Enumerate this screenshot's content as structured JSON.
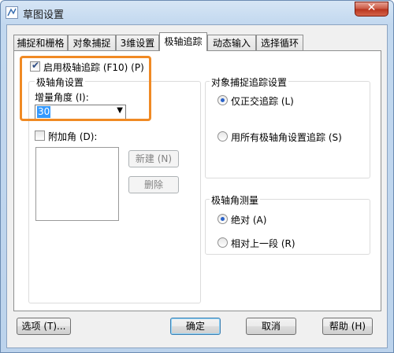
{
  "window": {
    "title": "草图设置",
    "close_glyph": "✕"
  },
  "tabs": [
    "捕捉和栅格",
    "对象捕捉",
    "3维设置",
    "极轴追踪",
    "动态输入",
    "选择循环"
  ],
  "active_tab": "极轴追踪",
  "polar": {
    "enable_label": "启用极轴追踪 (F10) (P)",
    "enable_checked": true,
    "settings_group": "极轴角设置",
    "increment_label": "增量角度 (I):",
    "increment_value": "30",
    "additional_label": "附加角 (D):",
    "additional_checked": false,
    "new_button": "新建 (N)",
    "delete_button": "删除"
  },
  "snap_tracking": {
    "group_label": "对象捕捉追踪设置",
    "options": [
      "仅正交追踪 (L)",
      "用所有极轴角设置追踪 (S)"
    ],
    "selected": 0
  },
  "polar_measurement": {
    "group_label": "极轴角测量",
    "options": [
      "绝对 (A)",
      "相对上一段 (R)"
    ],
    "selected": 0
  },
  "footer": {
    "options_button": "选项 (T)...",
    "ok_button": "确定",
    "cancel_button": "取消",
    "help_button": "帮助 (H)"
  },
  "colors": {
    "highlight": "#f08a24",
    "radio_selected": "#2a62c8",
    "close_button": "#c85640"
  }
}
